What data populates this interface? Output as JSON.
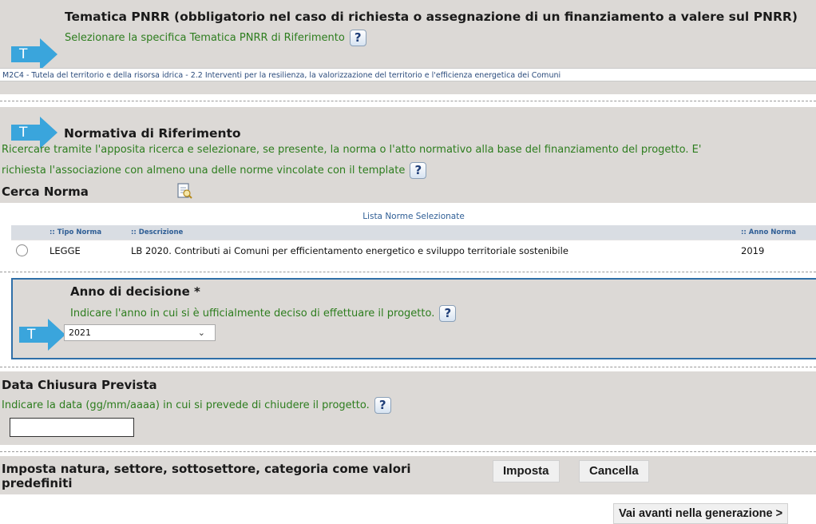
{
  "pnrr": {
    "title": "Tematica PNRR (obbligatorio nel caso di richiesta o assegnazione di un finanziamento a valere sul PNRR)",
    "hint": "Selezionare la specifica Tematica PNRR di Riferimento",
    "selected": "M2C4 - Tutela del territorio e della risorsa idrica - 2.2 Interventi per la resilienza, la valorizzazione del territorio e l'efficienza energetica dei Comuni",
    "arrow_letter": "T"
  },
  "normativa": {
    "title": "Normativa di Riferimento",
    "hint_line1": "Ricercare tramite l'apposita ricerca e selezionare, se presente, la norma o l'atto normativo alla base del finanziamento del progetto. E'",
    "hint_line2": "richiesta l'associazione con almeno una delle norme vincolate con il template",
    "arrow_letter": "T",
    "search_label": "Cerca Norma",
    "table": {
      "caption": "Lista Norme Selezionate",
      "headers": [
        ":: Tipo Norma",
        ":: Descrizione",
        ":: Anno Norma"
      ],
      "rows": [
        {
          "tipo": "LEGGE",
          "descrizione": "LB 2020. Contributi ai Comuni per efficientamento energetico e sviluppo territoriale sostenibile",
          "anno": "2019"
        }
      ]
    }
  },
  "anno": {
    "title": "Anno di decisione *",
    "hint": "Indicare l'anno in cui si è ufficialmente deciso di effettuare il progetto.",
    "value": "2021",
    "arrow_letter": "T"
  },
  "chiusura": {
    "title": "Data Chiusura Prevista",
    "hint": "Indicare la data (gg/mm/aaaa) in cui si prevede di chiudere il progetto.",
    "value": ""
  },
  "imposta": {
    "label_line1": "Imposta natura, settore, sottosettore, categoria come valori",
    "label_line2": "predefiniti",
    "imposta_button": "Imposta",
    "cancella_button": "Cancella"
  },
  "help_symbol": "?",
  "next_button": "Vai avanti nella generazione >",
  "colors": {
    "panel": "#dcd9d6",
    "arrow": "#3aa5dc",
    "hint_green": "#2d7d1e",
    "link_blue": "#2f5e95"
  }
}
